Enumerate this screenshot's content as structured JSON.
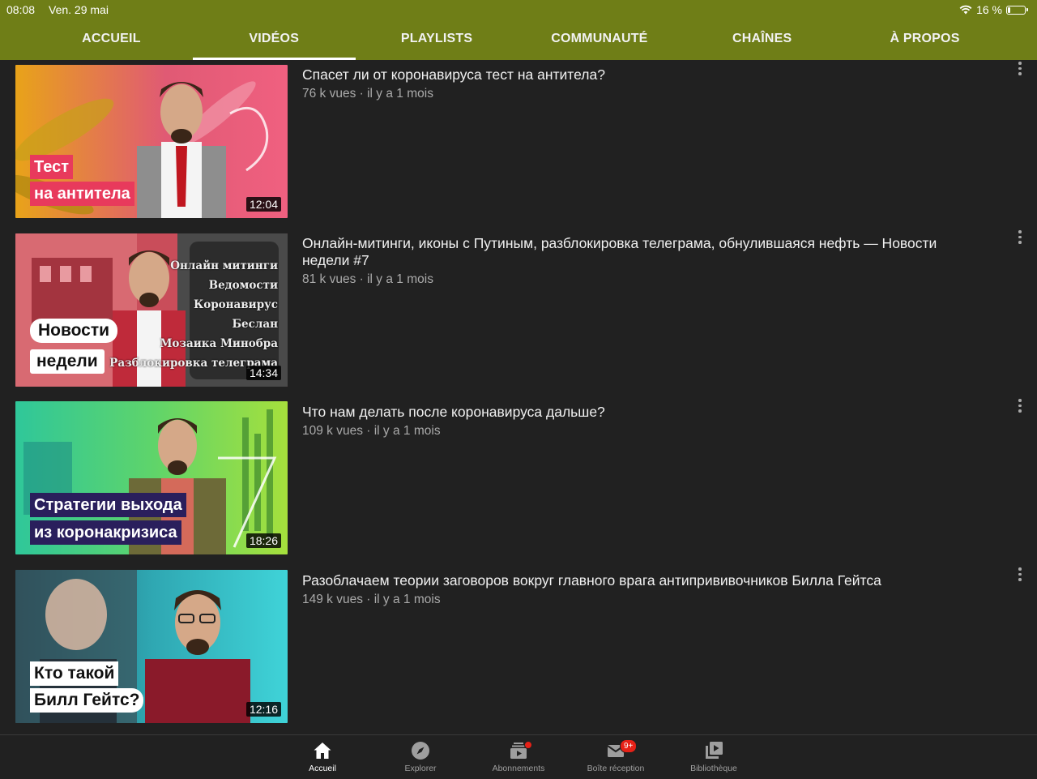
{
  "status": {
    "time": "08:08",
    "date": "Ven. 29 mai",
    "battery": "16 %",
    "battery_level": 0.16
  },
  "tabs": [
    {
      "label": "ACCUEIL",
      "active": false
    },
    {
      "label": "VIDÉOS",
      "active": true
    },
    {
      "label": "PLAYLISTS",
      "active": false
    },
    {
      "label": "COMMUNAUTÉ",
      "active": false
    },
    {
      "label": "CHAÎNES",
      "active": false
    },
    {
      "label": "À PROPOS",
      "active": false
    }
  ],
  "videos": [
    {
      "title": "Спасет ли от коронавируса тест на антитела?",
      "meta": "76 k vues · il y a 1 mois",
      "duration": "12:04",
      "thumb_caption": [
        "Тест",
        "на антитела"
      ]
    },
    {
      "title": "Онлайн-митинги, иконы с Путиным, разблокировка телеграма, обнулившаяся нефть — Новости недели #7",
      "meta": "81 k vues · il y a 1 mois",
      "duration": "14:34",
      "thumb_caption": [
        "Новости",
        "недели"
      ],
      "thumb_topics": [
        "Онлайн митинги",
        "Ведомости",
        "Коронавирус",
        "Беслан",
        "Мозаика Минобра",
        "Разблокировка телеграма"
      ]
    },
    {
      "title": "Что нам делать после коронавируса дальше?",
      "meta": "109 k vues · il y a 1 mois",
      "duration": "18:26",
      "thumb_caption": [
        "Стратегии выхода",
        "из коронакризиса"
      ]
    },
    {
      "title": "Разоблачаем теории заговоров вокруг главного врага антипрививочников Билла Гейтса",
      "meta": "149 k vues · il y a 1 mois",
      "duration": "12:16",
      "thumb_caption": [
        "Кто такой",
        "Билл Гейтс?"
      ]
    }
  ],
  "bottom_nav": [
    {
      "label": "Accueil",
      "icon": "home-icon",
      "active": true
    },
    {
      "label": "Explorer",
      "icon": "compass-icon",
      "active": false
    },
    {
      "label": "Abonnements",
      "icon": "subscriptions-icon",
      "active": false
    },
    {
      "label": "Boîte réception",
      "icon": "inbox-icon",
      "active": false,
      "badge": "9+"
    },
    {
      "label": "Bibliothèque",
      "icon": "library-icon",
      "active": false
    }
  ],
  "colors": {
    "header": "#6f7e17",
    "background": "#212121",
    "badge": "#e62117"
  }
}
